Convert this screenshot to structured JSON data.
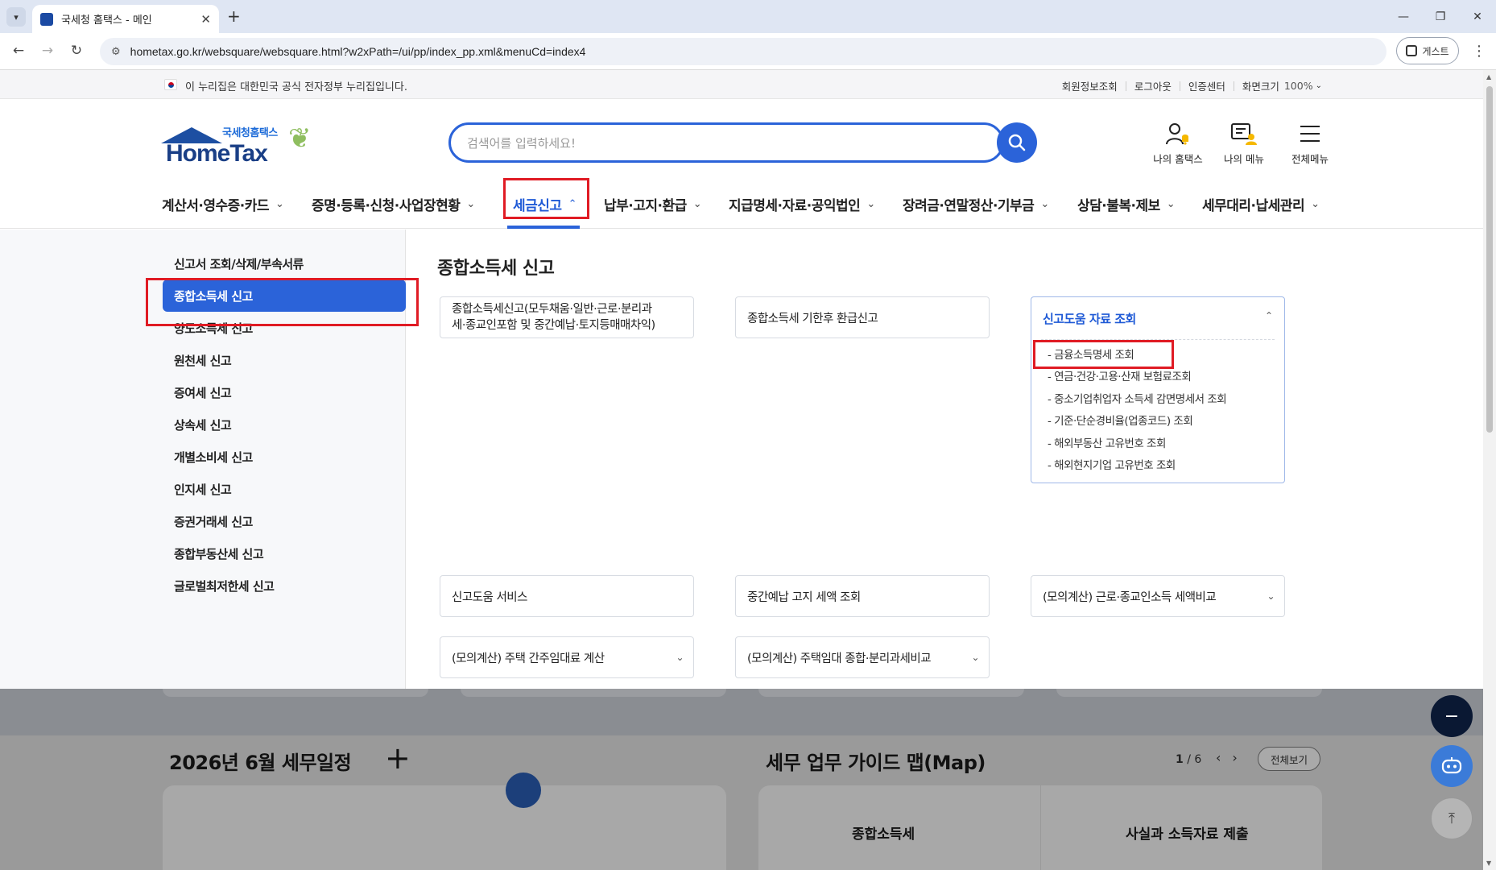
{
  "browser": {
    "tab_title": "국세청 홈택스 - 메인",
    "url": "hometax.go.kr/websquare/websquare.html?w2xPath=/ui/pp/index_pp.xml&menuCd=index4",
    "guest_label": "게스트"
  },
  "gov_bar": {
    "notice": "이 누리집은 대한민국 공식 전자정부 누리집입니다.",
    "links": [
      "회원정보조회",
      "로그아웃",
      "인증센터",
      "화면크기"
    ],
    "zoom_value": "100%"
  },
  "header": {
    "logo_sub": "국세청홈택스",
    "logo_main": "HomeTax",
    "search_placeholder": "검색어를 입력하세요!",
    "icons": {
      "my_hometax": "나의 홈택스",
      "my_menu": "나의 메뉴",
      "all_menu": "전체메뉴"
    }
  },
  "gnb": {
    "items": [
      "계산서·영수증·카드",
      "증명·등록·신청·사업장현황",
      "세금신고",
      "납부·고지·환급",
      "지급명세·자료·공익법인",
      "장려금·연말정산·기부금",
      "상담·불복·제보",
      "세무대리·납세관리"
    ],
    "active_index": 2
  },
  "mega_menu": {
    "left_items": [
      "신고서 조회/삭제/부속서류",
      "종합소득세 신고",
      "양도소득세 신고",
      "원천세 신고",
      "증여세 신고",
      "상속세 신고",
      "개별소비세 신고",
      "인지세 신고",
      "증권거래세 신고",
      "종합부동산세 신고",
      "글로벌최저한세 신고"
    ],
    "active_left_index": 1,
    "title": "종합소득세 신고",
    "cards": {
      "c1_line1": "종합소득세신고(모두채움·일반·근로·분리과",
      "c1_line2": "세·종교인포함 및 중간예납·토지등매매차익)",
      "c2": "종합소득세 기한후 환급신고",
      "c3": "신고도움 서비스",
      "c4": "중간예납 고지 세액 조회",
      "c5": "(모의계산) 근로·종교인소득 세액비교",
      "c6": "(모의계산) 주택 간주임대료 계산",
      "c7": "(모의계산) 주택임대 종합·분리과세비교"
    },
    "open_card": {
      "title": "신고도움 자료 조회",
      "items": [
        "금융소득명세 조회",
        "연금·건강·고용·산재 보험료조회",
        "중소기업취업자 소득세 감면명세서 조회",
        "기준·단순경비율(업종코드) 조회",
        "해외부동산 고유번호 조회",
        "해외현지기업 고유번호 조회"
      ]
    }
  },
  "below": {
    "schedule_title": "2026년 6월 세무일정",
    "guide_title": "세무 업무 가이드 맵(Map)",
    "pager_current": "1",
    "pager_total": "/ 6",
    "view_all": "전체보기",
    "panel_text_1": "종합소득세",
    "panel_text_2": "사실과 소득자료 제출"
  },
  "colors": {
    "primary": "#2b63d9",
    "highlight_box": "#e01b24",
    "logo_navy": "#1a3f86"
  }
}
